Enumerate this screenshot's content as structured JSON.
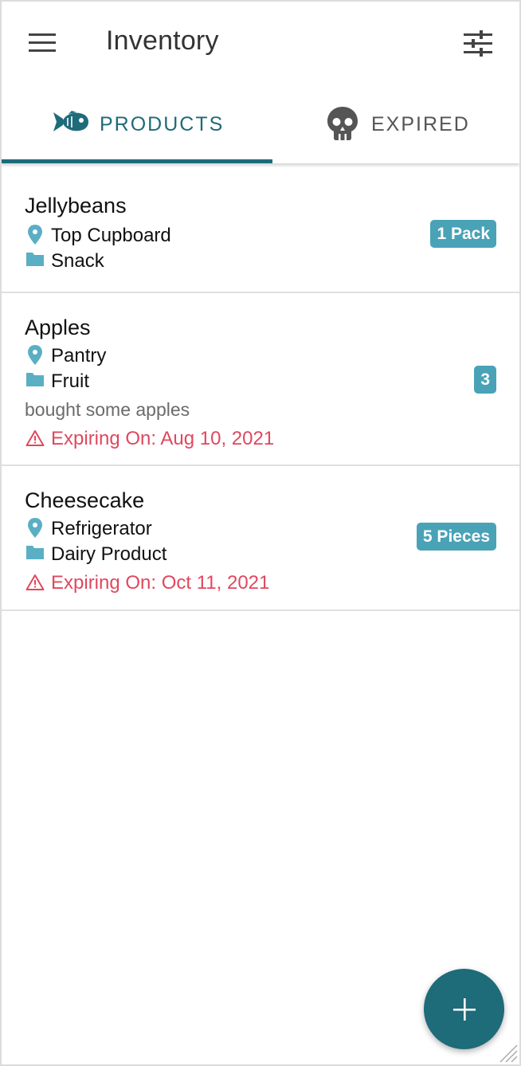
{
  "app": {
    "title": "Inventory"
  },
  "colors": {
    "primary": "#1e6b7a",
    "badge": "#4aa2b7",
    "meta_icon": "#5aafc4",
    "expiry": "#e0485e"
  },
  "tabs": [
    {
      "label": "PRODUCTS",
      "icon": "fish-icon",
      "selected": true
    },
    {
      "label": "EXPIRED",
      "icon": "skull-icon",
      "selected": false
    }
  ],
  "products": [
    {
      "name": "Jellybeans",
      "location": "Top Cupboard",
      "category": "Snack",
      "quantity": "1 Pack"
    },
    {
      "name": "Apples",
      "location": "Pantry",
      "category": "Fruit",
      "note": "bought some apples",
      "expiry": "Expiring On: Aug 10, 2021",
      "quantity": "3"
    },
    {
      "name": "Cheesecake",
      "location": "Refrigerator",
      "category": "Dairy Product",
      "expiry": "Expiring On: Oct 11, 2021",
      "quantity": "5 Pieces"
    }
  ],
  "icons": {
    "menu": "hamburger-menu-icon",
    "filter": "sliders-icon",
    "location": "map-pin-icon",
    "category": "folder-icon",
    "warning": "warning-triangle-icon",
    "add": "plus-icon"
  }
}
